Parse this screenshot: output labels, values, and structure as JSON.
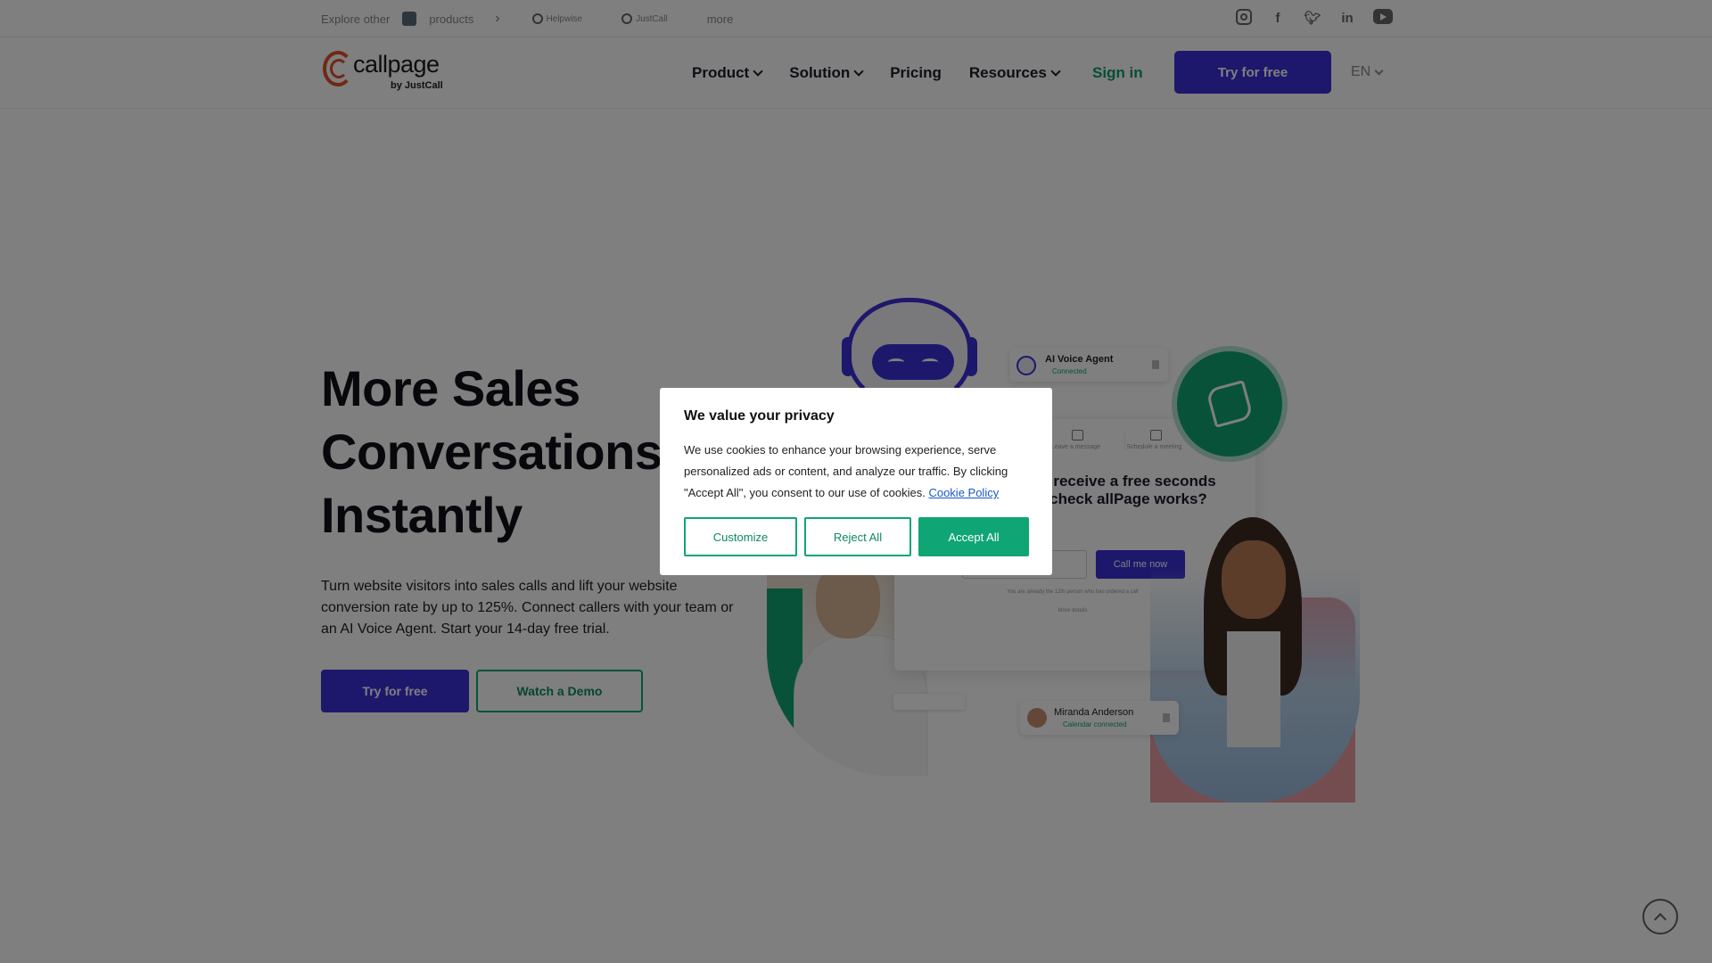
{
  "topbar": {
    "explore_label": "Explore other",
    "products_label": "products",
    "brands": [
      "Helpwise",
      "JustCall"
    ],
    "more_label": "more",
    "social_icons": [
      "instagram-icon",
      "facebook-icon",
      "twitter-icon",
      "linkedin-icon",
      "youtube-icon"
    ]
  },
  "nav": {
    "logo_text": "callpage",
    "logo_sub": "by JustCall",
    "menu": [
      "Product",
      "Solution",
      "Pricing",
      "Resources"
    ],
    "signin": "Sign in",
    "try_label": "Try for free",
    "language": "EN"
  },
  "hero": {
    "title_lines": [
      "More Sales",
      "Conversations,",
      "Instantly"
    ],
    "subtitle": "Turn website visitors into sales calls and lift your website conversion rate by up to 125%. Connect callers with your team or an AI Voice Agent. Start your 14-day free trial.",
    "try_label": "Try for free",
    "demo_label": "Watch a Demo"
  },
  "illustration": {
    "ai_card_title": "AI Voice Agent",
    "ai_card_status": "Connected",
    "widget_tabs": [
      "Leave a message",
      "Schedule a meeting"
    ],
    "widget_question": "ike to receive a free seconds and check allPage works?",
    "widget_call_button": "Call me now",
    "widget_counter": "You are already the 12th person who has ordered a call",
    "widget_more": "More details",
    "agent_card_name": "Miranda Anderson",
    "agent_card_status": "Calendar connected"
  },
  "cookie_dialog": {
    "title": "We value your privacy",
    "body": "We use cookies to enhance your browsing experience, serve personalized ads or content, and analyze our traffic. By clicking \"Accept All\", you consent to our use of cookies.",
    "policy_link": "Cookie Policy",
    "customize": "Customize",
    "reject": "Reject All",
    "accept": "Accept All"
  },
  "colors": {
    "primary": "#3a31d8",
    "accent_green": "#10a574",
    "logo_orange": "#e0502a"
  }
}
